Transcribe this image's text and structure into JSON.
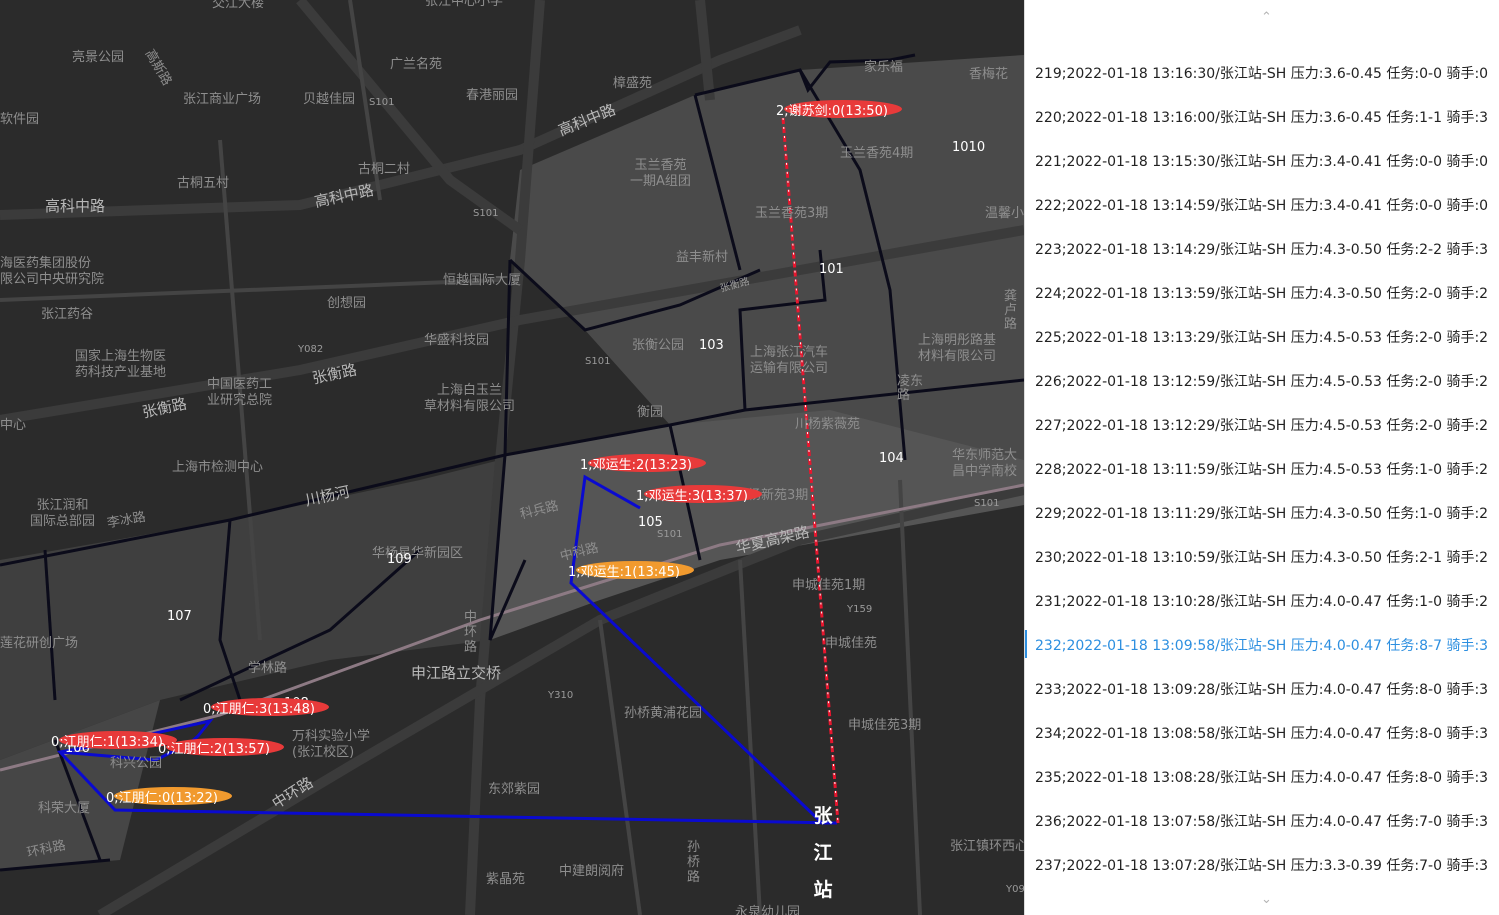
{
  "map": {
    "place_labels": [
      {
        "id": "jiaoda",
        "text": "交江大楼"
      },
      {
        "id": "zjzx",
        "text": "张江中心小学"
      },
      {
        "id": "liangjing",
        "text": "亮景公园"
      },
      {
        "id": "gaoshi",
        "text": "高斯路"
      },
      {
        "id": "zjsy",
        "text": "张江商业广场"
      },
      {
        "id": "beiyu",
        "text": "贝越佳园"
      },
      {
        "id": "guanglan",
        "text": "广兰名苑"
      },
      {
        "id": "s101a",
        "text": "S101"
      },
      {
        "id": "chungang",
        "text": "春港丽园"
      },
      {
        "id": "zhangsheng",
        "text": "樟盛苑"
      },
      {
        "id": "ruanjian",
        "text": "软件园"
      },
      {
        "id": "gutong2",
        "text": "古桐二村"
      },
      {
        "id": "gutong5",
        "text": "古桐五村"
      },
      {
        "id": "yulan",
        "text": "玉兰香苑\n一期A组团"
      },
      {
        "id": "jialefu",
        "text": "家乐福"
      },
      {
        "id": "xiangmei",
        "text": "香梅花"
      },
      {
        "id": "yulan4",
        "text": "玉兰香苑4期"
      },
      {
        "id": "yulan3",
        "text": "玉兰香苑3期"
      },
      {
        "id": "wenxin",
        "text": "温馨小"
      },
      {
        "id": "yaoji",
        "text": "海医药集团股份\n限公司中央研究院"
      },
      {
        "id": "s101b",
        "text": "S101"
      },
      {
        "id": "yifeng",
        "text": "益丰新村"
      },
      {
        "id": "hengyue",
        "text": "恒越国际大厦"
      },
      {
        "id": "zjyg",
        "text": "张江药谷"
      },
      {
        "id": "chuangxiang",
        "text": "创想园"
      },
      {
        "id": "zhangheng2",
        "text": "张衡路"
      },
      {
        "id": "gonglu",
        "text": "龚\n卢\n路"
      },
      {
        "id": "huasheng",
        "text": "华盛科技园"
      },
      {
        "id": "zhgy",
        "text": "张衡公园"
      },
      {
        "id": "s101c",
        "text": "S101"
      },
      {
        "id": "y082",
        "text": "Y082"
      },
      {
        "id": "zjqc",
        "text": "上海张江汽车\n运输有限公司"
      },
      {
        "id": "mingtong",
        "text": "上海明彤路基\n材料有限公司"
      },
      {
        "id": "guojia",
        "text": "国家上海生物医\n药科技产业基地"
      },
      {
        "id": "zhongguo",
        "text": "中国医药工\n业研究总院"
      },
      {
        "id": "zhanghengrd",
        "text": "张衡路"
      },
      {
        "id": "baiyu",
        "text": "上海白玉兰\n草材料有限公司"
      },
      {
        "id": "heyuan",
        "text": "衡园"
      },
      {
        "id": "chuanyang",
        "text": "川杨紫薇苑"
      },
      {
        "id": "huadong",
        "text": "华东师范大\n昌中学南校"
      },
      {
        "id": "zhangheng",
        "text": "张衡路"
      },
      {
        "id": "lingdong",
        "text": "凌东\n路"
      },
      {
        "id": "jiance",
        "text": "上海市检测中心"
      },
      {
        "id": "zxin",
        "text": "中心"
      },
      {
        "id": "chuanyanghe",
        "text": "川杨河"
      },
      {
        "id": "kebing",
        "text": "科兵路"
      },
      {
        "id": "chuanyang3",
        "text": "川杨新苑3期"
      },
      {
        "id": "zjrh",
        "text": "张江润和\n国际总部园"
      },
      {
        "id": "libing",
        "text": "李冰路"
      },
      {
        "id": "s101d",
        "text": "S101"
      },
      {
        "id": "s101e",
        "text": "S101"
      },
      {
        "id": "huaxia",
        "text": "华夏高架路"
      },
      {
        "id": "huawu",
        "text": "华杨星华新园区"
      },
      {
        "id": "zhongke",
        "text": "中科路"
      },
      {
        "id": "shenzheng",
        "text": "申城佳苑1期"
      },
      {
        "id": "y159",
        "text": "Y159"
      },
      {
        "id": "zhonghuan1",
        "text": "中\n环\n路"
      },
      {
        "id": "lianhua",
        "text": "莲花研创广场"
      },
      {
        "id": "xuelin",
        "text": "学林路"
      },
      {
        "id": "shenjiang",
        "text": "申江路立交桥"
      },
      {
        "id": "shencheng",
        "text": "申城佳苑"
      },
      {
        "id": "y310",
        "text": "Y310"
      },
      {
        "id": "sunqiao",
        "text": "孙桥黄浦花园"
      },
      {
        "id": "wanke",
        "text": "万科实验小学\n(张江校区)"
      },
      {
        "id": "shencheng3",
        "text": "申城佳苑3期"
      },
      {
        "id": "kexinggongyuan",
        "text": "科兴公园"
      },
      {
        "id": "zhonghuan",
        "text": "中环路"
      },
      {
        "id": "dongjiao",
        "text": "东郊紫园"
      },
      {
        "id": "kerong",
        "text": "科荣大厦"
      },
      {
        "id": "huanke",
        "text": "环科路"
      },
      {
        "id": "sunqiaolu",
        "text": "孙\n桥\n路"
      },
      {
        "id": "zjzhxi",
        "text": "张江镇环西心"
      },
      {
        "id": "zhongjian",
        "text": "中建朗阅府"
      },
      {
        "id": "zijing",
        "text": "紫晶苑"
      },
      {
        "id": "y09",
        "text": "Y09"
      },
      {
        "id": "yongquan",
        "text": "永泉幼儿园"
      },
      {
        "id": "gaoke1",
        "text": "高科中路"
      },
      {
        "id": "gaoke2",
        "text": "高科中路"
      },
      {
        "id": "gaoke3",
        "text": "高科中路"
      }
    ],
    "zones": [
      {
        "id": "z1010",
        "text": "1010"
      },
      {
        "id": "z101",
        "text": "101"
      },
      {
        "id": "z103",
        "text": "103"
      },
      {
        "id": "z104",
        "text": "104"
      },
      {
        "id": "z105",
        "text": "105"
      },
      {
        "id": "z109",
        "text": "109"
      },
      {
        "id": "z107",
        "text": "107"
      },
      {
        "id": "z108",
        "text": "108"
      },
      {
        "id": "z106",
        "text": "106"
      }
    ],
    "markers": [
      {
        "id": "xie0",
        "text": "2;谢苏剑:0(13:50)",
        "color": "#e83a3a"
      },
      {
        "id": "deng2",
        "text": "1;邓运生:2(13:23)",
        "color": "#e83a3a"
      },
      {
        "id": "deng3",
        "text": "1;邓运生:3(13:37)",
        "color": "#e83a3a"
      },
      {
        "id": "deng1",
        "text": "1;邓运生:1(13:45)",
        "color": "#f19a2e"
      },
      {
        "id": "jiang3",
        "text": "0;江朋仁:3(13:48)",
        "color": "#e83a3a"
      },
      {
        "id": "jiang1",
        "text": "0;江朋仁:1(13:34)",
        "color": "#e83a3a"
      },
      {
        "id": "jiang2",
        "text": "0;江朋仁:2(13:57)",
        "color": "#e83a3a"
      },
      {
        "id": "jiang0",
        "text": "0;江朋仁:0(13:22)",
        "color": "#f19a2e"
      }
    ],
    "station_label": "张江站",
    "route_color": "#0a0ad0",
    "dashed_route_color": "#e8162e"
  },
  "panel": {
    "up_icon": "chevron-up-icon",
    "down_icon": "chevron-down-icon",
    "active_index": 13,
    "active_color": "#2d8fe0",
    "logs": [
      "219;2022-01-18 13:16:30/张江站-SH 压力:3.6-0.45 任务:0-0 骑手:0",
      "220;2022-01-18 13:16:00/张江站-SH 压力:3.6-0.45 任务:1-1 骑手:3",
      "221;2022-01-18 13:15:30/张江站-SH 压力:3.4-0.41 任务:0-0 骑手:0",
      "222;2022-01-18 13:14:59/张江站-SH 压力:3.4-0.41 任务:0-0 骑手:0",
      "223;2022-01-18 13:14:29/张江站-SH 压力:4.3-0.50 任务:2-2 骑手:3",
      "224;2022-01-18 13:13:59/张江站-SH 压力:4.3-0.50 任务:2-0 骑手:2",
      "225;2022-01-18 13:13:29/张江站-SH 压力:4.5-0.53 任务:2-0 骑手:2",
      "226;2022-01-18 13:12:59/张江站-SH 压力:4.5-0.53 任务:2-0 骑手:2",
      "227;2022-01-18 13:12:29/张江站-SH 压力:4.5-0.53 任务:2-0 骑手:2",
      "228;2022-01-18 13:11:59/张江站-SH 压力:4.5-0.53 任务:1-0 骑手:2",
      "229;2022-01-18 13:11:29/张江站-SH 压力:4.3-0.50 任务:1-0 骑手:2",
      "230;2022-01-18 13:10:59/张江站-SH 压力:4.3-0.50 任务:2-1 骑手:2",
      "231;2022-01-18 13:10:28/张江站-SH 压力:4.0-0.47 任务:1-0 骑手:2",
      "232;2022-01-18 13:09:58/张江站-SH 压力:4.0-0.47 任务:8-7 骑手:3",
      "233;2022-01-18 13:09:28/张江站-SH 压力:4.0-0.47 任务:8-0 骑手:3",
      "234;2022-01-18 13:08:58/张江站-SH 压力:4.0-0.47 任务:8-0 骑手:3",
      "235;2022-01-18 13:08:28/张江站-SH 压力:4.0-0.47 任务:8-0 骑手:3",
      "236;2022-01-18 13:07:58/张江站-SH 压力:4.0-0.47 任务:7-0 骑手:3",
      "237;2022-01-18 13:07:28/张江站-SH 压力:3.3-0.39 任务:7-0 骑手:3"
    ]
  }
}
